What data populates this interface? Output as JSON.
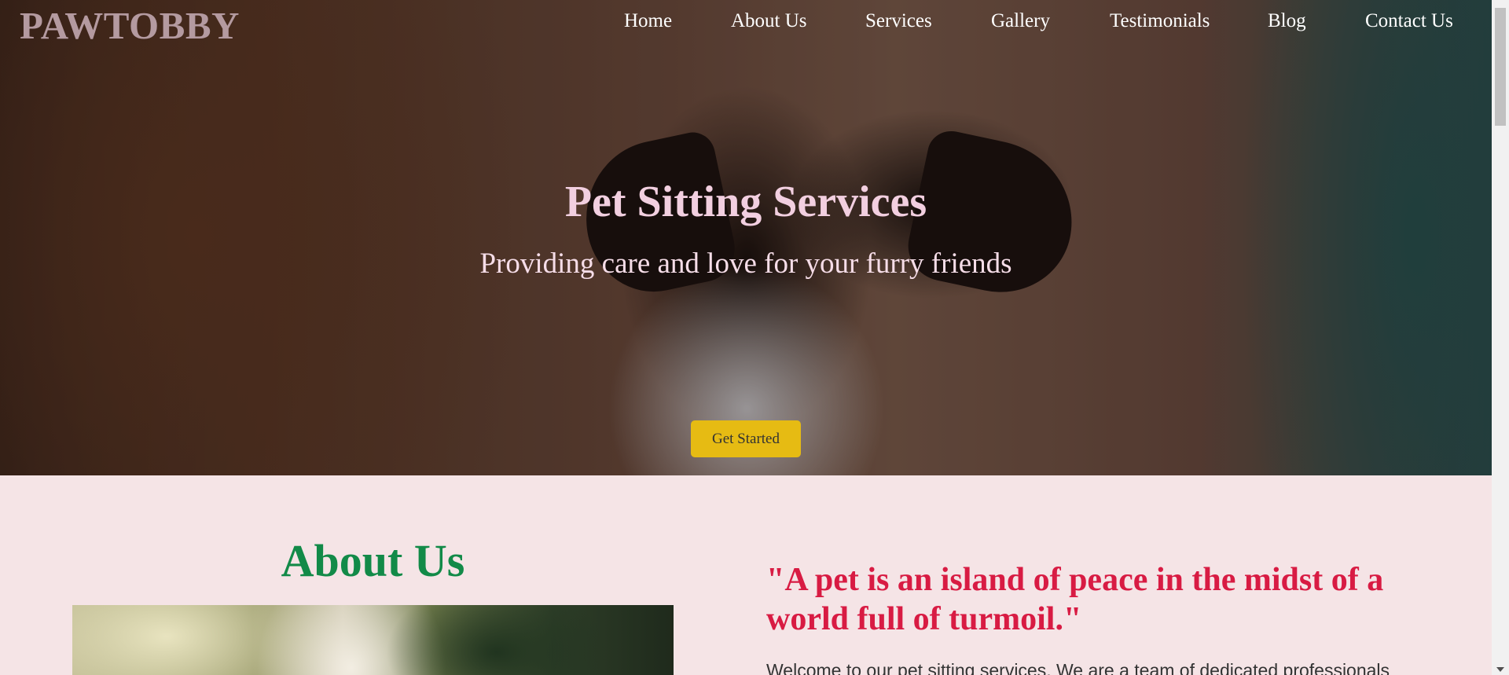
{
  "brand": {
    "logo_text": "PAWTOBBY"
  },
  "nav": {
    "items": [
      {
        "label": "Home"
      },
      {
        "label": "About Us"
      },
      {
        "label": "Services"
      },
      {
        "label": "Gallery"
      },
      {
        "label": "Testimonials"
      },
      {
        "label": "Blog"
      },
      {
        "label": "Contact Us"
      }
    ]
  },
  "hero": {
    "title": "Pet Sitting Services",
    "subtitle": "Providing care and love for your furry friends",
    "cta_label": "Get Started"
  },
  "about": {
    "heading": "About Us",
    "quote": "\"A pet is an island of peace in the midst of a world full of turmoil.\"",
    "intro": "Welcome to our pet sitting services. We are a team of dedicated professionals"
  },
  "colors": {
    "logo": "#b49aa0",
    "hero_title": "#f2cfe0",
    "cta_background": "#e6bb13",
    "page_background": "#f5e4e6",
    "about_heading": "#128a48",
    "quote": "#d81b43"
  },
  "icons": {
    "scroll_down": "chevron-down-icon"
  }
}
